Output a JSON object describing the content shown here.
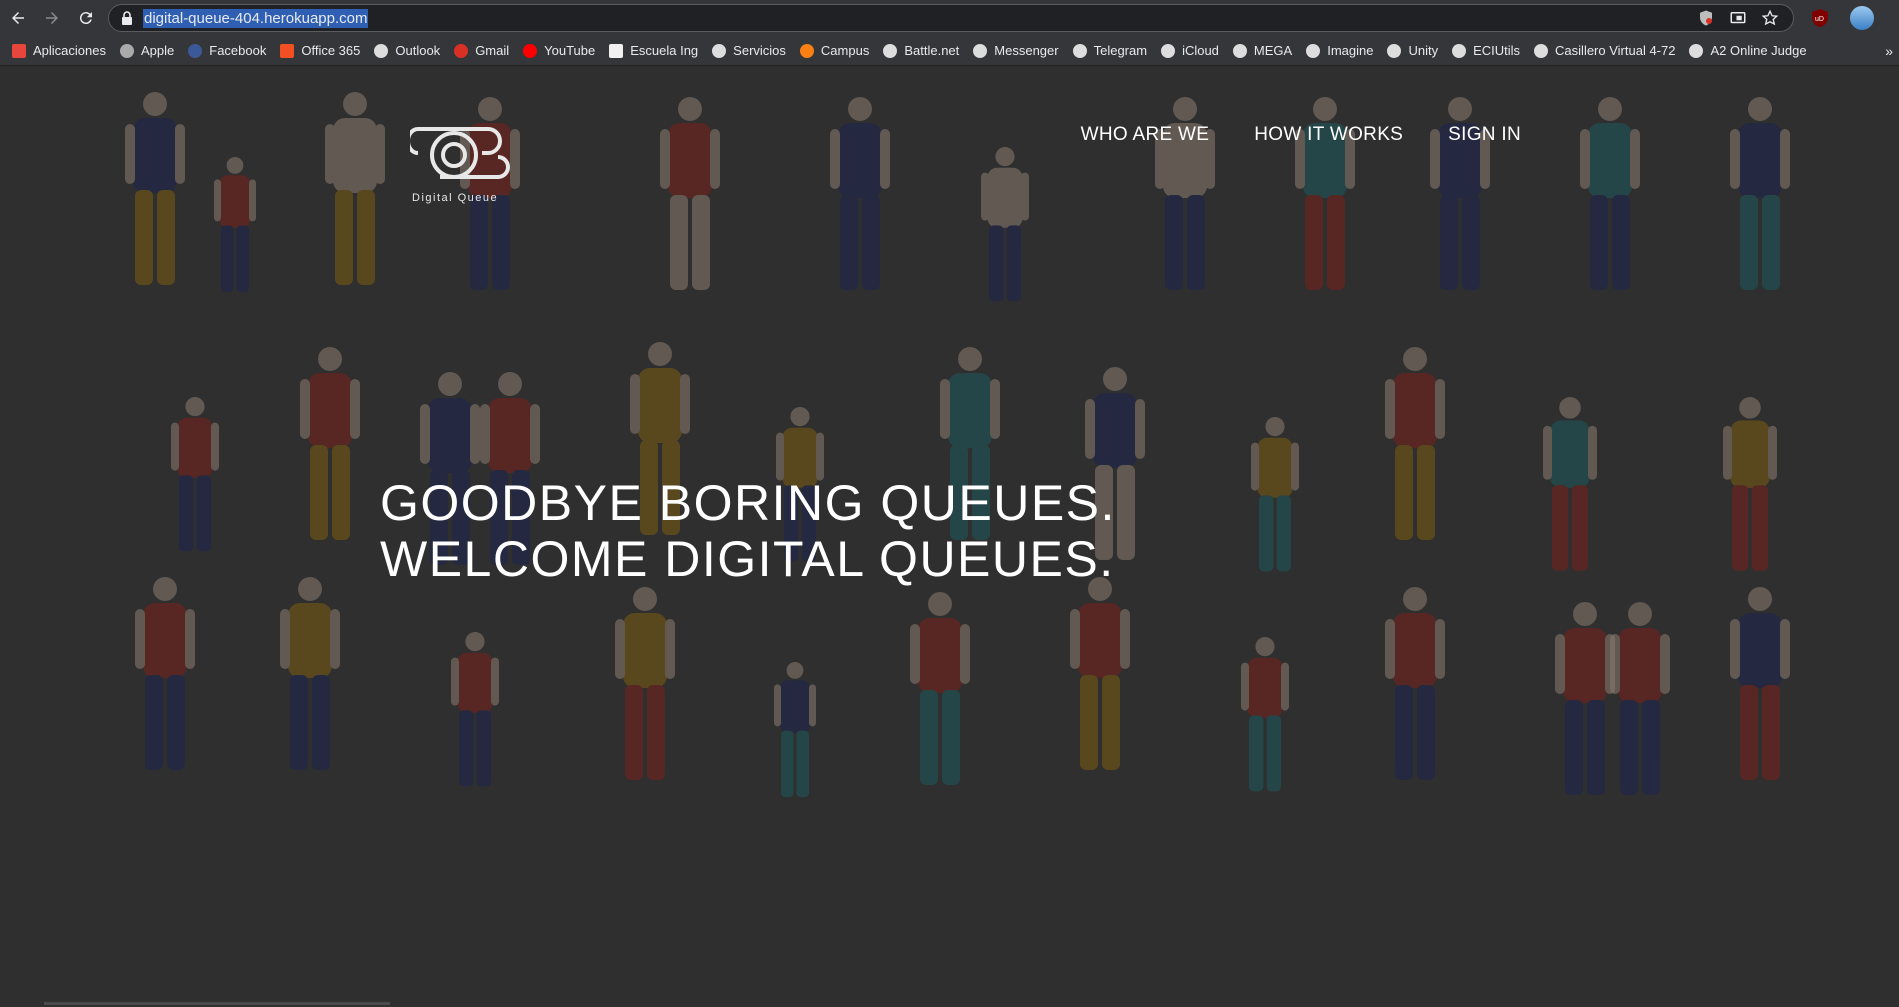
{
  "browser": {
    "url": "digital-queue-404.herokuapp.com",
    "bookmarks": [
      {
        "label": "Aplicaciones",
        "icon": "apps-grid-icon",
        "color": "#e8453c"
      },
      {
        "label": "Apple",
        "icon": "apple-icon",
        "color": "#aaaaaa"
      },
      {
        "label": "Facebook",
        "icon": "facebook-icon",
        "color": "#3b5998"
      },
      {
        "label": "Office 365",
        "icon": "office-icon",
        "color": "#f25022"
      },
      {
        "label": "Outlook",
        "icon": "globe-icon",
        "color": "#dddddd"
      },
      {
        "label": "Gmail",
        "icon": "gmail-icon",
        "color": "#d93025"
      },
      {
        "label": "YouTube",
        "icon": "youtube-icon",
        "color": "#ff0000"
      },
      {
        "label": "Escuela Ing",
        "icon": "page-icon",
        "color": "#f1f1f1"
      },
      {
        "label": "Servicios",
        "icon": "globe-icon",
        "color": "#dddddd"
      },
      {
        "label": "Campus",
        "icon": "moodle-icon",
        "color": "#f98012"
      },
      {
        "label": "Battle.net",
        "icon": "globe-icon",
        "color": "#dddddd"
      },
      {
        "label": "Messenger",
        "icon": "globe-icon",
        "color": "#dddddd"
      },
      {
        "label": "Telegram",
        "icon": "globe-icon",
        "color": "#dddddd"
      },
      {
        "label": "iCloud",
        "icon": "globe-icon",
        "color": "#dddddd"
      },
      {
        "label": "MEGA",
        "icon": "globe-icon",
        "color": "#dddddd"
      },
      {
        "label": "Imagine",
        "icon": "globe-icon",
        "color": "#dddddd"
      },
      {
        "label": "Unity",
        "icon": "globe-icon",
        "color": "#dddddd"
      },
      {
        "label": "ECIUtils",
        "icon": "globe-icon",
        "color": "#dddddd"
      },
      {
        "label": "Casillero Virtual 4-72",
        "icon": "globe-icon",
        "color": "#dddddd"
      },
      {
        "label": "A2 Online Judge",
        "icon": "globe-icon",
        "color": "#dddddd"
      }
    ],
    "more": "»"
  },
  "site": {
    "logo_text": "Digital Queue",
    "nav": {
      "who": "WHO ARE WE",
      "how": "HOW IT WORKS",
      "signin": "SIGN IN"
    },
    "hero_line1": "GOODBYE BORING QUEUES.",
    "hero_line2": "WELCOME DIGITAL QUEUES."
  },
  "colors": {
    "background": "#2f2f2f",
    "navy": "#1d2451",
    "red": "#7a1f1a",
    "mustard": "#7d5b0f",
    "teal": "#1e5a5e",
    "skin_light": "#8a7c6f",
    "skin_dark": "#3b2a1f"
  }
}
